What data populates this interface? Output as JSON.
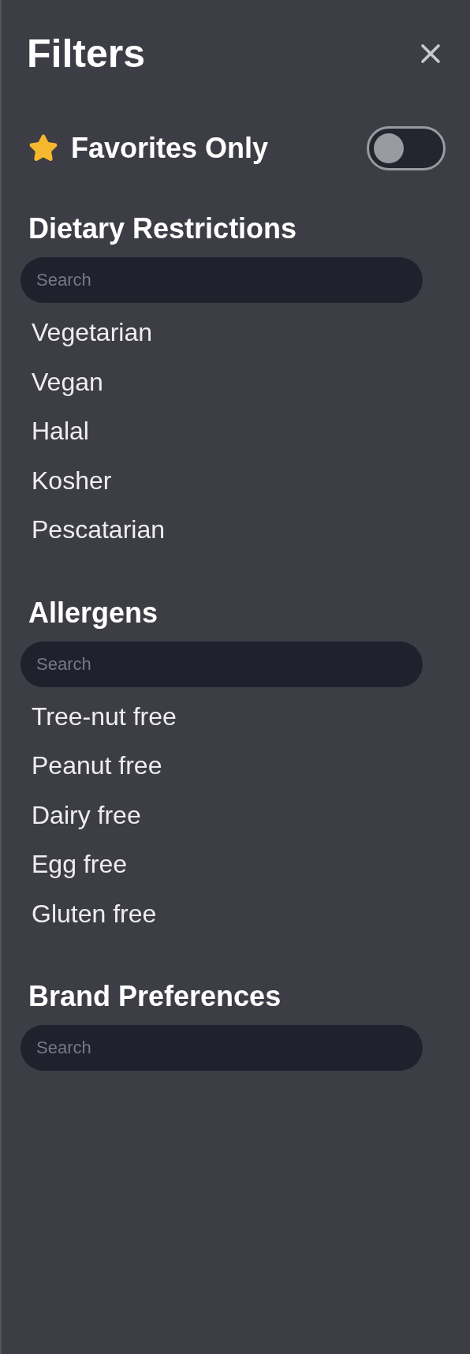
{
  "title": "Filters",
  "favorites": {
    "label": "Favorites Only",
    "on": false
  },
  "sections": [
    {
      "title": "Dietary Restrictions",
      "search": {
        "placeholder": "Search"
      },
      "items": [
        "Vegetarian",
        "Vegan",
        "Halal",
        "Kosher",
        "Pescatarian"
      ]
    },
    {
      "title": "Allergens",
      "search": {
        "placeholder": "Search"
      },
      "items": [
        "Tree-nut free",
        "Peanut free",
        "Dairy free",
        "Egg free",
        "Gluten free"
      ]
    },
    {
      "title": "Brand Preferences",
      "search": {
        "placeholder": "Search"
      }
    }
  ]
}
